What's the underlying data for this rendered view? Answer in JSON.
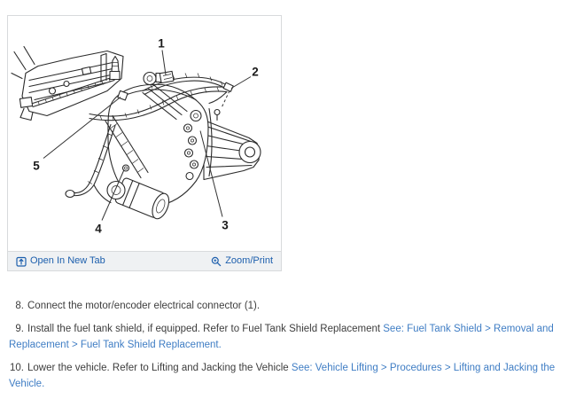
{
  "figure_viewer": {
    "footer": {
      "open_in_new_tab_label": "Open In New Tab",
      "zoom_print_label": "Zoom/Print",
      "open_in_new_tab_icon": "open-in-new-tab",
      "zoom_print_icon": "magnifier-plus"
    },
    "diagram": {
      "callouts": [
        "1",
        "2",
        "3",
        "4",
        "5"
      ]
    }
  },
  "steps": [
    {
      "num": "8.",
      "text": "Connect the motor/encoder electrical connector (1).",
      "link": ""
    },
    {
      "num": "9.",
      "text": "Install the fuel tank shield, if equipped. Refer to Fuel Tank Shield Replacement ",
      "link": "See: Fuel Tank Shield > Removal and Replacement > Fuel Tank Shield Replacement."
    },
    {
      "num": "10.",
      "text": "Lower the vehicle. Refer to Lifting and Jacking the Vehicle ",
      "link": "See: Vehicle Lifting > Procedures > Lifting and Jacking the Vehicle."
    }
  ],
  "colors": {
    "toolbar_link": "#1d5fad",
    "body_link": "#3f7dc4",
    "body_text": "#3d3d3d",
    "line_art": "#2b2b2b",
    "footer_bg": "#eff1f3",
    "border": "#d8dadc"
  }
}
